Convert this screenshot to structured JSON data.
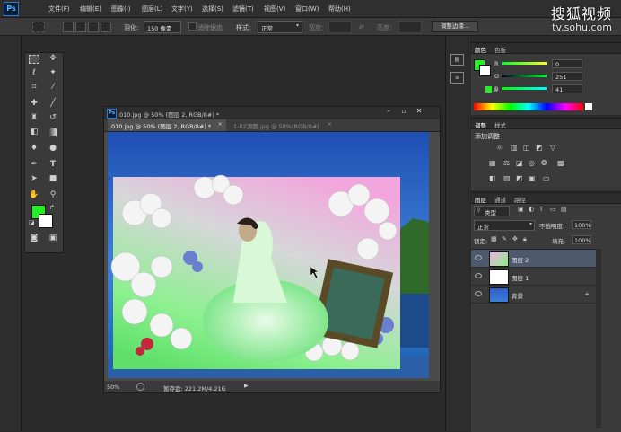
{
  "app": {
    "logo": "Ps"
  },
  "menu": [
    "文件(F)",
    "编辑(E)",
    "图像(I)",
    "图层(L)",
    "文字(Y)",
    "选择(S)",
    "滤镜(T)",
    "视图(V)",
    "窗口(W)",
    "帮助(H)"
  ],
  "options": {
    "feather_label": "羽化:",
    "feather_value": "150 像素",
    "antialias_label": "消除锯齿",
    "style_label": "样式:",
    "style_value": "正常",
    "width_label": "宽度:",
    "height_label": "高度:",
    "refine_button": "调整边缘..."
  },
  "watermark": {
    "text": "搜狐视频",
    "url": "tv.sohu.com"
  },
  "document": {
    "title": "010.jpg @ 50% (图层 2, RGB/8#) *",
    "tabs": [
      "010.jpg @ 50% (图层 2, RGB/8#) *",
      "1-02源图.jpg @ 50%(RGB/8#)"
    ],
    "zoom": "50%",
    "scratch_label": "暂存盘: 221.2M/4.21G"
  },
  "color_panel": {
    "tabs": [
      "颜色",
      "色板"
    ],
    "channels": [
      {
        "label": "R",
        "value": "0"
      },
      {
        "label": "G",
        "value": "251"
      },
      {
        "label": "B",
        "value": "41"
      }
    ],
    "colors": {
      "foreground": "#22f022",
      "background": "#ffffff"
    }
  },
  "adjust_panel": {
    "tabs": [
      "调整",
      "样式"
    ],
    "title": "添加调整"
  },
  "layers_panel": {
    "tabs": [
      "图层",
      "通道",
      "路径"
    ],
    "filter_label": "类型",
    "blend_mode": "正常",
    "opacity_label": "不透明度:",
    "opacity_value": "100%",
    "lock_label": "锁定:",
    "fill_label": "填充:",
    "fill_value": "100%",
    "layers": [
      {
        "name": "图层 2",
        "active": true
      },
      {
        "name": "图层 1",
        "active": false
      },
      {
        "name": "背景",
        "active": false
      }
    ]
  }
}
